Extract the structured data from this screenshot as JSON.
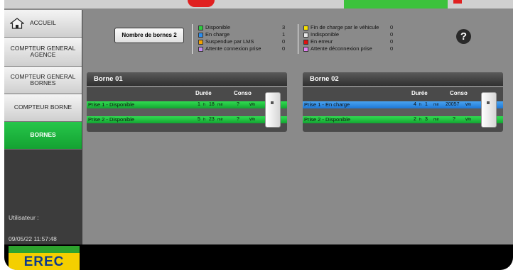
{
  "sidebar": {
    "items": [
      {
        "label": "ACCUEIL"
      },
      {
        "label": "COMPTEUR GENERAL AGENCE"
      },
      {
        "label": "COMPTEUR GENERAL BORNES"
      },
      {
        "label": "COMPTEUR BORNE"
      },
      {
        "label": "BORNES"
      }
    ],
    "active": "BORNES",
    "user_label": "Utilisateur :",
    "datetime": "09/05/22   11:57:48"
  },
  "header": {
    "nb_bornes": "Nombre de bornes  2",
    "help": "?"
  },
  "legend": {
    "left": [
      {
        "label": "Disponible",
        "count": "3",
        "color": "#2ecc40"
      },
      {
        "label": "En charge",
        "count": "1",
        "color": "#2a8ef0"
      },
      {
        "label": "Suspendue par LMS",
        "count": "0",
        "color": "#f4a300"
      },
      {
        "label": "Attente connexion prise",
        "count": "0",
        "color": "#c08bf0"
      }
    ],
    "right": [
      {
        "label": "Fin de charge par le véhicule",
        "count": "0",
        "color": "#f7e000"
      },
      {
        "label": "Indisponible",
        "count": "0",
        "color": "#e8e8e8"
      },
      {
        "label": "En erreur",
        "count": "0",
        "color": "#e01010"
      },
      {
        "label": "Attente déconnexion prise",
        "count": "0",
        "color": "#e080f0"
      }
    ]
  },
  "bornes": [
    {
      "title": "Borne 01",
      "col_duree": "Durée",
      "col_conso": "Conso",
      "prises": [
        {
          "name": "Prise 1 - ",
          "status": "Disponible",
          "h": "1",
          "h_unit": "h",
          "m": "18",
          "m_unit": "mir",
          "conso": "?",
          "unit": "Wh",
          "color": "green"
        },
        {
          "name": "Prise 2 - ",
          "status": "Disponible",
          "h": "5",
          "h_unit": "h",
          "m": "23",
          "m_unit": "mir",
          "conso": "?",
          "unit": "Wh",
          "color": "green"
        }
      ]
    },
    {
      "title": "Borne 02",
      "col_duree": "Durée",
      "col_conso": "Conso",
      "prises": [
        {
          "name": "Prise 1 - ",
          "status": "En charge",
          "h": "4",
          "h_unit": "h",
          "m": "1",
          "m_unit": "mir",
          "conso": "20057",
          "unit": "Wh",
          "color": "blue"
        },
        {
          "name": "Prise 2 - ",
          "status": "Disponible",
          "h": "2",
          "h_unit": "h",
          "m": "3",
          "m_unit": "mir",
          "conso": "?",
          "unit": "Wh",
          "color": "green"
        }
      ]
    }
  ],
  "logo": "EREC"
}
